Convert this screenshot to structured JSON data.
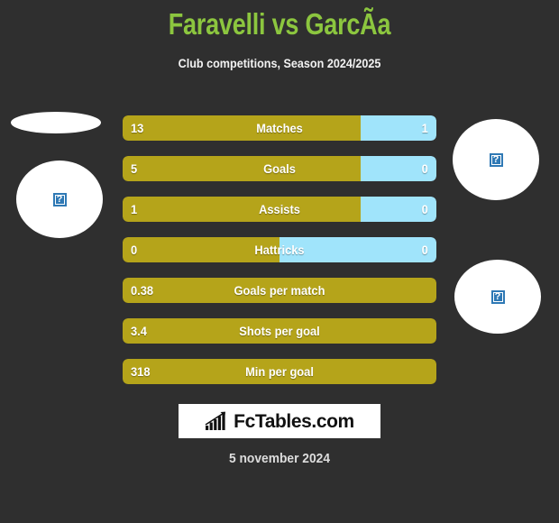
{
  "header": {
    "title": "Faravelli vs GarcÃ­a",
    "subtitle": "Club competitions, Season 2024/2025"
  },
  "colors": {
    "background": "#2f2f2f",
    "title_green": "#8cc63f",
    "home_gold": "#b5a41a",
    "away_blue": "#a0e4fb",
    "text_white": "#ffffff"
  },
  "placeholders": {
    "left_club_logo": "broken-image-icon",
    "left_player_photo": "broken-image-icon",
    "right_club_logo": "broken-image-icon",
    "right_player_photo": "broken-image-icon",
    "glyph": "?"
  },
  "chart_data": {
    "type": "bar",
    "title": "Faravelli vs GarcÃ­a",
    "subtitle": "Club competitions, Season 2024/2025",
    "orientation": "horizontal-diverging",
    "series": [
      {
        "name": "Faravelli",
        "side": "left",
        "color": "#b5a41a"
      },
      {
        "name": "GarcÃ­a",
        "side": "right",
        "color": "#a0e4fb"
      }
    ],
    "categories": [
      "Matches",
      "Goals",
      "Assists",
      "Hattricks",
      "Goals per match",
      "Shots per goal",
      "Min per goal"
    ],
    "rows": [
      {
        "label": "Matches",
        "home": "13",
        "away": "1",
        "home_pct": 76,
        "away_pct": 24,
        "split": true
      },
      {
        "label": "Goals",
        "home": "5",
        "away": "0",
        "home_pct": 76,
        "away_pct": 24,
        "split": true
      },
      {
        "label": "Assists",
        "home": "1",
        "away": "0",
        "home_pct": 76,
        "away_pct": 24,
        "split": true
      },
      {
        "label": "Hattricks",
        "home": "0",
        "away": "0",
        "home_pct": 50,
        "away_pct": 50,
        "split": true
      },
      {
        "label": "Goals per match",
        "home": "0.38",
        "away": "",
        "home_pct": 100,
        "away_pct": 0,
        "split": false
      },
      {
        "label": "Shots per goal",
        "home": "3.4",
        "away": "",
        "home_pct": 100,
        "away_pct": 0,
        "split": false
      },
      {
        "label": "Min per goal",
        "home": "318",
        "away": "",
        "home_pct": 100,
        "away_pct": 0,
        "split": false
      }
    ]
  },
  "footer": {
    "logo_text": "FcTables.com",
    "logo_icon": "bar-chart-trend-icon",
    "date": "5 november 2024"
  }
}
